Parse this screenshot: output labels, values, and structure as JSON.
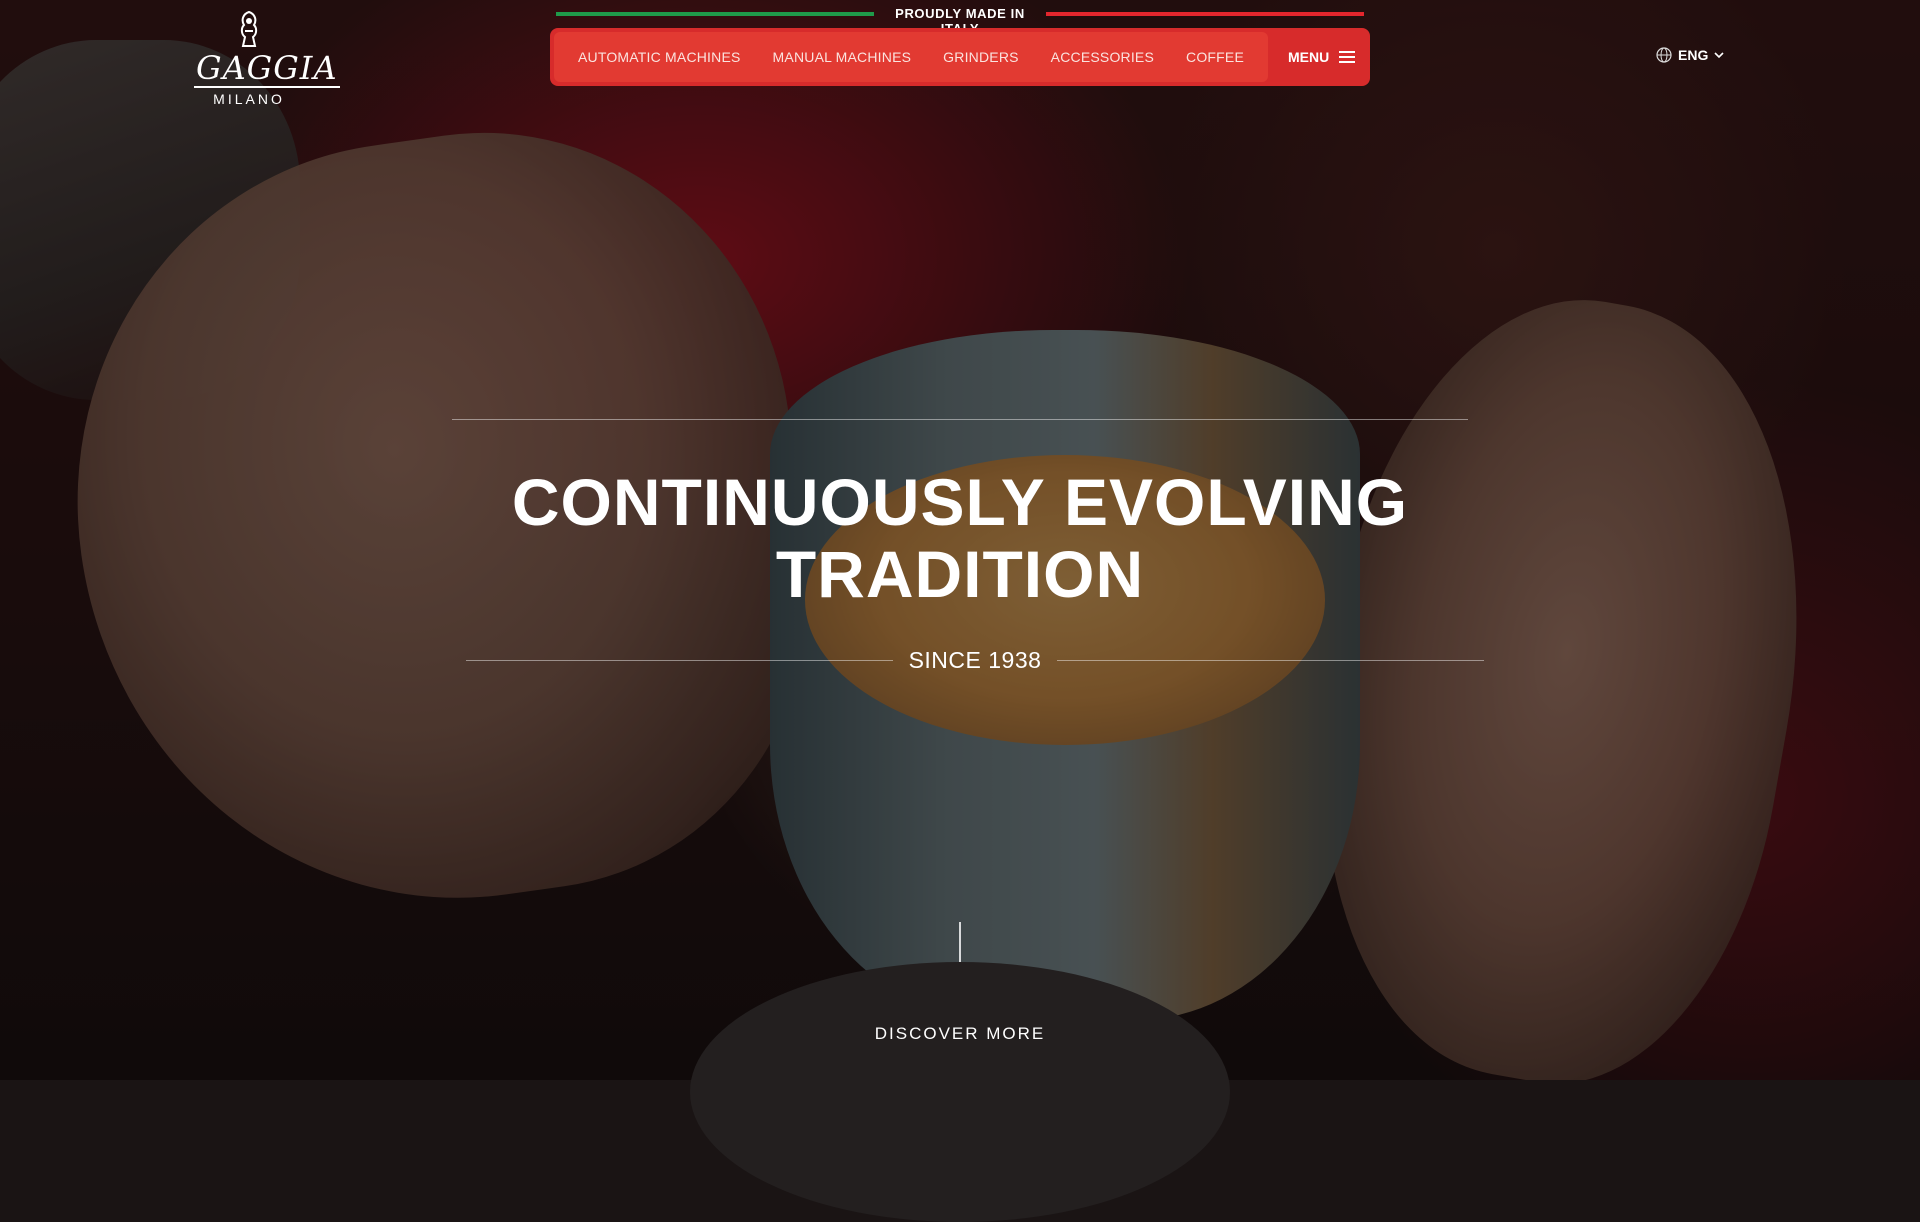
{
  "brand": {
    "name": "GAGGIA",
    "city": "MILANO"
  },
  "topbar": {
    "tagline": "PROUDLY MADE IN ITALY",
    "colors": {
      "green": "#1f9a4a",
      "red": "#e3262d"
    }
  },
  "nav": {
    "items": [
      {
        "label": "AUTOMATIC MACHINES"
      },
      {
        "label": "MANUAL MACHINES"
      },
      {
        "label": "GRINDERS"
      },
      {
        "label": "ACCESSORIES"
      },
      {
        "label": "COFFEE"
      }
    ],
    "menu_label": "MENU",
    "accent": "#d72b2b"
  },
  "language": {
    "selected": "ENG",
    "icon": "globe-icon"
  },
  "hero": {
    "title_line1": "CONTINUOUSLY EVOLVING",
    "title_line2": "TRADITION",
    "since": "SINCE 1938"
  },
  "cta": {
    "label": "DISCOVER MORE",
    "icon": "arrow-down-icon"
  }
}
